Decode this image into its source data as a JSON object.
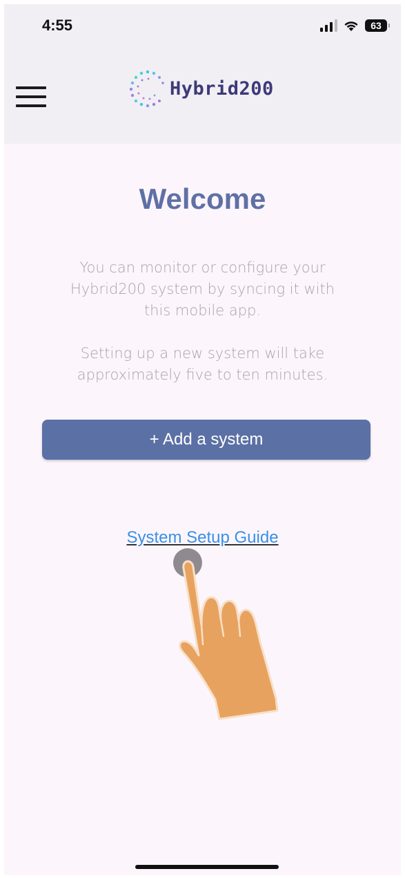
{
  "status_bar": {
    "time": "4:55",
    "battery": "63",
    "signal_icon": "cellular-signal-icon",
    "wifi_icon": "wifi-icon"
  },
  "header": {
    "menu_icon": "hamburger-menu-icon",
    "logo_text": "Hybrid200"
  },
  "main": {
    "title": "Welcome",
    "paragraph1": "You can monitor or configure your Hybrid200 system by syncing it with this mobile app.",
    "paragraph2": "Setting up a new system will take approximately five to ten minutes.",
    "add_button_label": "+ Add a system",
    "guide_link": "System Setup Guide"
  },
  "colors": {
    "accent": "#5b70a5",
    "title": "#5f70a5",
    "link": "#3a8fe4",
    "logo_text": "#3d3a78",
    "background": "#fcf6fc"
  }
}
